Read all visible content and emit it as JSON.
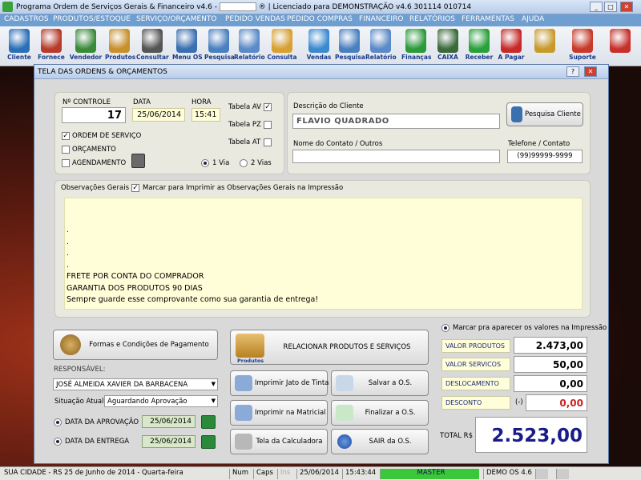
{
  "window": {
    "title": "Programa Ordem de Serviços Gerais & Financeiro v4.6 -",
    "title_suffix": "® | Licenciado para  DEMONSTRAÇÃO v4.6 301114 010714"
  },
  "menu": [
    "CADASTROS",
    "PRODUTOS/ESTOQUE",
    "SERVIÇO/ORÇAMENTO",
    "PEDIDO VENDAS",
    "PEDIDO COMPRAS",
    "FINANCEIRO",
    "RELATÓRIOS",
    "FERRAMENTAS",
    "AJUDA"
  ],
  "toolbar": [
    {
      "label": "Cliente",
      "icon": "client-person-icon",
      "color": "#2a6fb8"
    },
    {
      "label": "Fornece",
      "icon": "supplier-person-icon",
      "color": "#b83a2a"
    },
    {
      "label": "Vendedor",
      "icon": "seller-person-icon",
      "color": "#3a8a3a"
    },
    {
      "label": "Produtos",
      "icon": "boxes-icon",
      "color": "#c8902a"
    },
    {
      "label": "Consultar",
      "icon": "barcode-icon",
      "color": "#555555"
    },
    {
      "label": "Menu OS",
      "icon": "clipboard-icon",
      "color": "#3a6fb0"
    },
    {
      "label": "Pesquisa",
      "icon": "magnifier-doc-icon",
      "color": "#4a80c0"
    },
    {
      "label": "Relatório",
      "icon": "printer-icon",
      "color": "#5a8ac8"
    },
    {
      "label": "Consulta",
      "icon": "folder-icon",
      "color": "#d8a030"
    },
    {
      "label": "Vendas",
      "icon": "monitor-icon",
      "color": "#3a8ad0"
    },
    {
      "label": "Pesquisa",
      "icon": "magnifier-doc-icon",
      "color": "#4a80c0"
    },
    {
      "label": "Relatório",
      "icon": "printer-icon",
      "color": "#5a8ac8"
    },
    {
      "label": "Finanças",
      "icon": "dollar-chart-icon",
      "color": "#2a9a3a"
    },
    {
      "label": "CAIXA",
      "icon": "cashbox-icon",
      "color": "#3a6a3a"
    },
    {
      "label": "Receber",
      "icon": "green-dollar-icon",
      "color": "#2aa03a"
    },
    {
      "label": "A Pagar",
      "icon": "red-dollar-icon",
      "color": "#c82a2a"
    },
    {
      "label": "",
      "icon": "coins-icon",
      "color": "#c89a2a"
    },
    {
      "label": "Suporte",
      "icon": "support-person-icon",
      "color": "#c83a2a"
    },
    {
      "label": "",
      "icon": "exit-door-icon",
      "color": "#c8302a"
    }
  ],
  "dialog": {
    "title": "TELA DAS ORDENS & ORÇAMENTOS",
    "controle_label": "Nº CONTROLE",
    "controle_value": "17",
    "data_label": "DATA",
    "data_value": "25/06/2014",
    "hora_label": "HORA",
    "hora_value": "15:41",
    "tabela_av": "Tabela AV",
    "tabela_pz": "Tabela PZ",
    "tabela_at": "Tabela AT",
    "ordem_servico": "ORDEM DE SERVIÇO",
    "orcamento": "ORÇAMENTO",
    "agendamento": "AGENDAMENTO",
    "via1": "1 Via",
    "via2": "2 Vias",
    "descricao_cliente_label": "Descrição do Cliente",
    "cliente_value": "FLAVIO QUADRADO",
    "pesquisa_cliente": "Pesquisa Cliente",
    "nome_contato_label": "Nome do Contato / Outros",
    "nome_contato_value": "",
    "telefone_label": "Telefone / Contato",
    "telefone_value": "(99)99999-9999",
    "observacoes_label": "Observações Gerais",
    "marcar_imprimir": "Marcar para Imprimir as Observações Gerais na Impressão",
    "obs_lines": [
      ".",
      ".",
      ".",
      ".",
      "FRETE POR CONTA DO COMPRADOR",
      "GARANTIA DOS PRODUTOS 90 DIAS",
      "Sempre guarde esse comprovante como sua garantia de entrega!"
    ],
    "formas_pagamento": "Formas e Condições de Pagamento",
    "relacionar": "RELACIONAR PRODUTOS E SERVIÇOS",
    "produtos_small": "Produtos",
    "responsavel_label": "RESPONSÁVEL:",
    "responsavel_value": "JOSÉ ALMEIDA XAVIER DA BARBACENA",
    "situacao_label": "Situação Atual",
    "situacao_value": "Aguardando Aprovação",
    "aprovacao_label": "DATA DA APROVAÇÃO",
    "aprovacao_value": "25/06/2014",
    "entrega_label": "DATA DA ENTREGA",
    "entrega_value": "25/06/2014",
    "btn_jato": "Imprimir Jato de Tinta",
    "btn_salvar": "Salvar a O.S.",
    "btn_matricial": "Imprimir na Matricial",
    "btn_finalizar": "Finalizar a O.S.",
    "btn_calc": "Tela da Calculadora",
    "btn_sair": "SAIR da O.S.",
    "marcar_valores": "Marcar pra aparecer os valores na Impressão",
    "valor_produtos_label": "VALOR PRODUTOS",
    "valor_produtos": "2.473,00",
    "valor_servicos_label": "VALOR SERVICOS",
    "valor_servicos": "50,00",
    "deslocamento_label": "DESLOCAMENTO",
    "deslocamento": "0,00",
    "desconto_label": "DESCONTO",
    "desconto_sign": "(-)",
    "desconto": "0,00",
    "total_label": "TOTAL R$",
    "total": "2.523,00"
  },
  "status": {
    "city": "SUA CIDADE - RS 25 de Junho de 2014 - Quarta-feira",
    "num": "Num",
    "caps": "Caps",
    "ins": "Ins",
    "date": "25/06/2014",
    "time": "15:43:44",
    "master": "MASTER",
    "demo": "DEMO OS 4.6"
  }
}
